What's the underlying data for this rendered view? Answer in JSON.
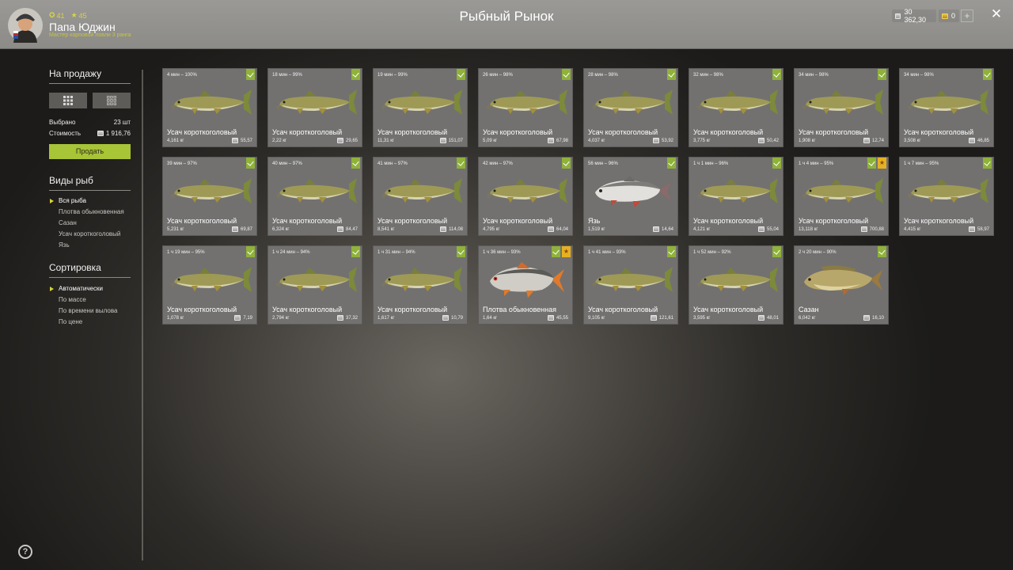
{
  "header": {
    "title": "Рыбный Рынок",
    "player_name": "Папа Юджин",
    "player_rank": "Мастер карповой ловли 3 ранга",
    "level": "41",
    "stars": "45",
    "silver": "30 362,30",
    "gold": "0",
    "plus_label": "+",
    "close_label": "✕"
  },
  "sidebar": {
    "sale_title": "На продажу",
    "selected_label": "Выбрано",
    "selected_value": "23 шт",
    "cost_label": "Стоимость",
    "cost_value": "1 916,76",
    "sell_label": "Продать",
    "species_title": "Виды рыб",
    "species": [
      "Вся рыба",
      "Плотва обыкновенная",
      "Сазан",
      "Усач короткоголовый",
      "Язь"
    ],
    "species_active": 0,
    "sort_title": "Сортировка",
    "sort_options": [
      "Автоматически",
      "По массе",
      "По времени вылова",
      "По цене"
    ],
    "sort_active": 0,
    "help_label": "?"
  },
  "colors": {
    "accent_green": "#a8c437",
    "check_green": "#8fb23a",
    "star_gold": "#e7b020",
    "rank_yellow": "#c9c43c"
  },
  "cards": [
    {
      "time": "4 мин – 100%",
      "name": "Усач короткоголовый",
      "weight": "4,161 кг",
      "price": "55,57",
      "kind": "barbel",
      "star": false
    },
    {
      "time": "18 мин – 99%",
      "name": "Усач короткоголовый",
      "weight": "2,22 кг",
      "price": "29,65",
      "kind": "barbel",
      "star": false
    },
    {
      "time": "19 мин – 99%",
      "name": "Усач короткоголовый",
      "weight": "11,31 кг",
      "price": "151,07",
      "kind": "barbel",
      "star": false
    },
    {
      "time": "26 мин – 98%",
      "name": "Усач короткоголовый",
      "weight": "5,09 кг",
      "price": "67,98",
      "kind": "barbel",
      "star": false
    },
    {
      "time": "28 мин – 98%",
      "name": "Усач короткоголовый",
      "weight": "4,037 кг",
      "price": "53,92",
      "kind": "barbel",
      "star": false
    },
    {
      "time": "32 мин – 98%",
      "name": "Усач короткоголовый",
      "weight": "3,775 кг",
      "price": "50,42",
      "kind": "barbel",
      "star": false
    },
    {
      "time": "34 мин – 98%",
      "name": "Усач короткоголовый",
      "weight": "1,908 кг",
      "price": "12,74",
      "kind": "barbel",
      "star": false
    },
    {
      "time": "34 мин – 98%",
      "name": "Усач короткоголовый",
      "weight": "3,508 кг",
      "price": "46,85",
      "kind": "barbel",
      "star": false
    },
    {
      "time": "39 мин – 97%",
      "name": "Усач короткоголовый",
      "weight": "5,231 кг",
      "price": "69,87",
      "kind": "barbel",
      "star": false
    },
    {
      "time": "40 мин – 97%",
      "name": "Усач короткоголовый",
      "weight": "6,324 кг",
      "price": "84,47",
      "kind": "barbel",
      "star": false
    },
    {
      "time": "41 мин – 97%",
      "name": "Усач короткоголовый",
      "weight": "8,541 кг",
      "price": "114,08",
      "kind": "barbel",
      "star": false
    },
    {
      "time": "42 мин – 97%",
      "name": "Усач короткоголовый",
      "weight": "4,795 кг",
      "price": "64,04",
      "kind": "barbel",
      "star": false
    },
    {
      "time": "56 мин – 96%",
      "name": "Язь",
      "weight": "1,519 кг",
      "price": "14,64",
      "kind": "ide",
      "star": false
    },
    {
      "time": "1 ч 1 мин – 96%",
      "name": "Усач короткоголовый",
      "weight": "4,121 кг",
      "price": "55,04",
      "kind": "barbel",
      "star": false
    },
    {
      "time": "1 ч 4 мин – 95%",
      "name": "Усач короткоголовый",
      "weight": "13,118 кг",
      "price": "700,88",
      "kind": "barbel",
      "star": true
    },
    {
      "time": "1 ч 7 мин – 95%",
      "name": "Усач короткоголовый",
      "weight": "4,415 кг",
      "price": "58,97",
      "kind": "barbel",
      "star": false
    },
    {
      "time": "1 ч 19 мин – 95%",
      "name": "Усач короткоголовый",
      "weight": "1,078 кг",
      "price": "7,19",
      "kind": "barbel",
      "star": false
    },
    {
      "time": "1 ч 24 мин – 94%",
      "name": "Усач короткоголовый",
      "weight": "2,794 кг",
      "price": "37,32",
      "kind": "barbel",
      "star": false
    },
    {
      "time": "1 ч 31 мин – 94%",
      "name": "Усач короткоголовый",
      "weight": "1,617 кг",
      "price": "10,79",
      "kind": "barbel",
      "star": false
    },
    {
      "time": "1 ч 36 мин – 93%",
      "name": "Плотва обыкновенная",
      "weight": "1,64 кг",
      "price": "45,55",
      "kind": "roach",
      "star": true
    },
    {
      "time": "1 ч 41 мин – 93%",
      "name": "Усач короткоголовый",
      "weight": "9,105 кг",
      "price": "121,61",
      "kind": "barbel",
      "star": false
    },
    {
      "time": "1 ч 52 мин – 92%",
      "name": "Усач короткоголовый",
      "weight": "3,595 кг",
      "price": "48,01",
      "kind": "barbel",
      "star": false
    },
    {
      "time": "2 ч 20 мин – 90%",
      "name": "Сазан",
      "weight": "6,042 кг",
      "price": "16,10",
      "kind": "carp",
      "star": false
    }
  ]
}
